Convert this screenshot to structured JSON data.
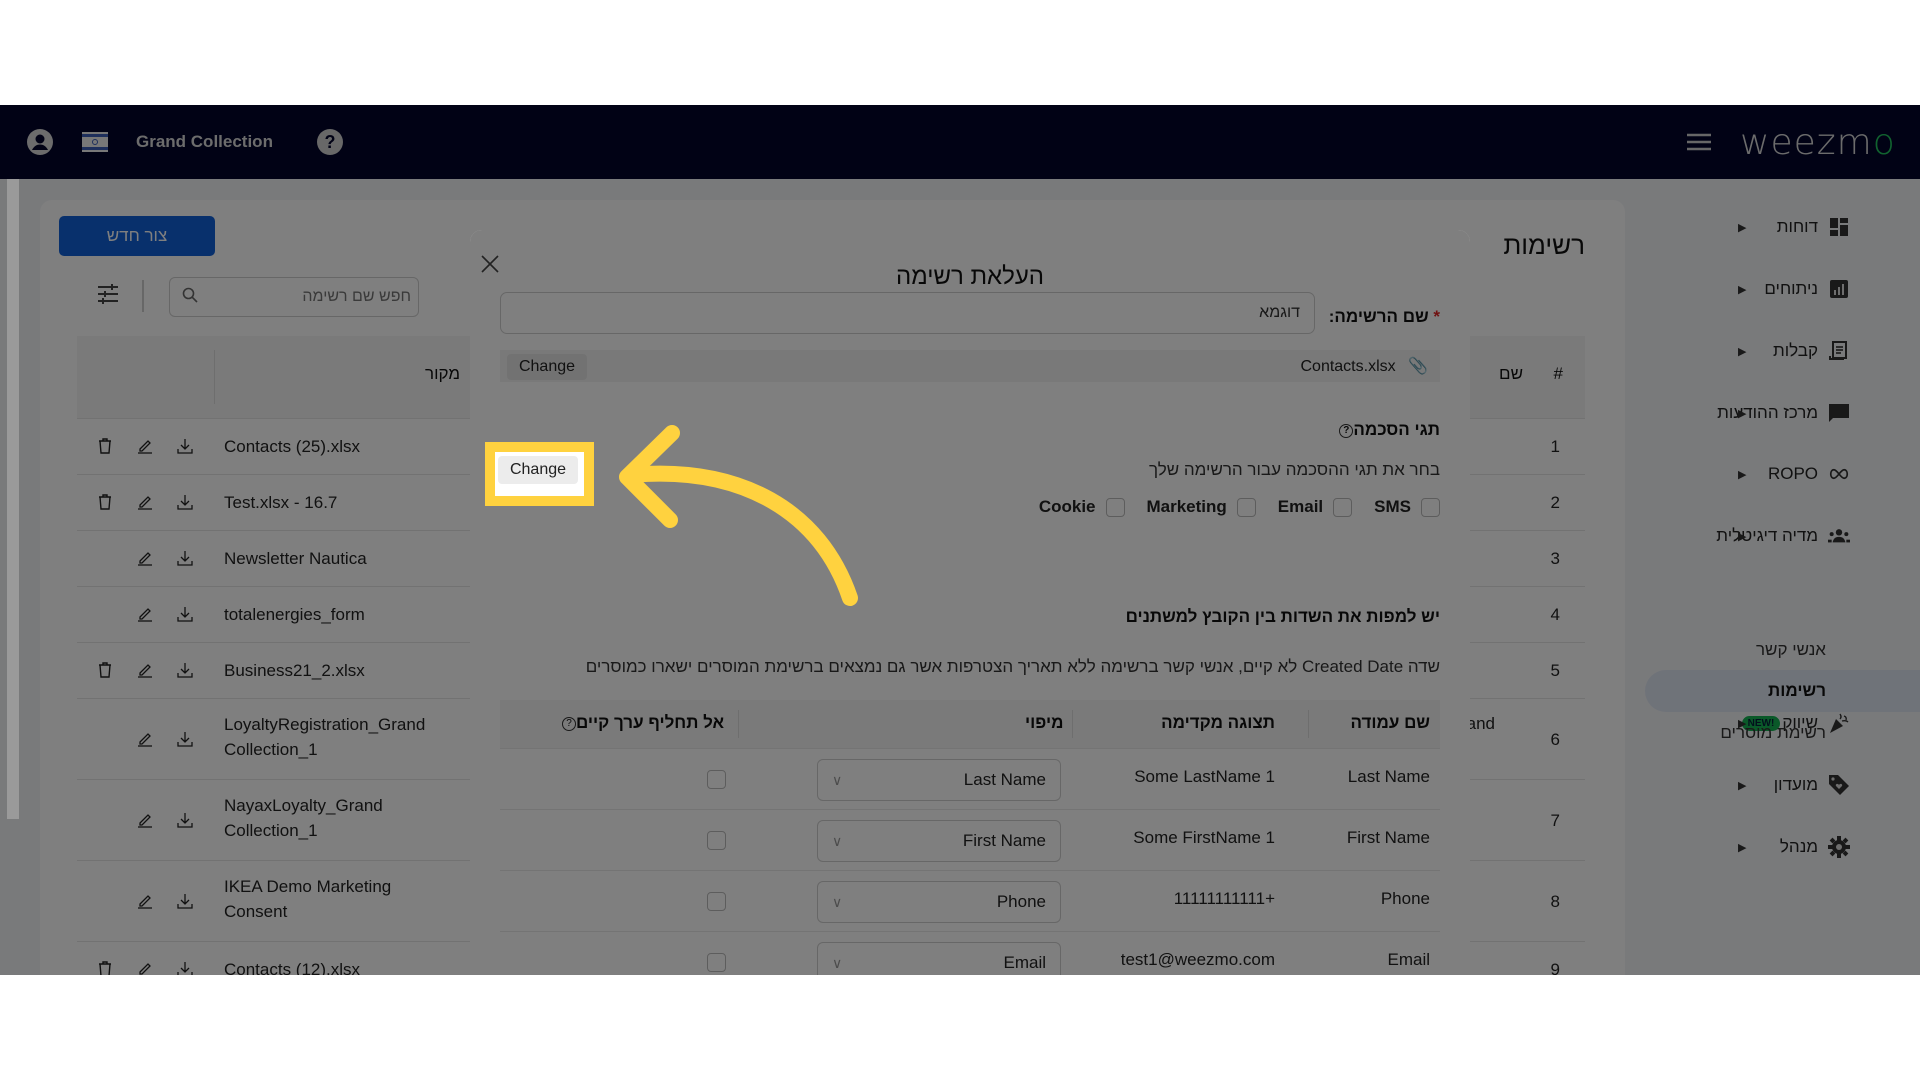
{
  "topbar": {
    "account_name": "Grand Collection",
    "user_icon": "user-circle-icon",
    "flag_icon": "israel-flag-icon",
    "help_icon": "help-circle-icon",
    "menu_icon": "hamburger-menu-icon",
    "logo": {
      "text_main": "weezm",
      "text_accent": "o"
    },
    "accent_color": "#22c55e",
    "bar_color": "#02052b"
  },
  "sidenav": {
    "items": [
      {
        "label": "דוחות",
        "icon": "dashboard-icon",
        "expanded": false
      },
      {
        "label": "ניתוחים",
        "icon": "bar-chart-icon",
        "expanded": false
      },
      {
        "label": "קבלות",
        "icon": "receipt-icon",
        "expanded": false
      },
      {
        "label": "מרכז ההודעות",
        "icon": "message-icon",
        "expanded": false
      },
      {
        "label": "ROPO",
        "icon": "infinity-icon",
        "expanded": false
      },
      {
        "label": "מדיה דיגיטלית",
        "icon": "people-icon",
        "expanded": false
      },
      {
        "label": "אנשי קשר",
        "icon": "contact-card-icon",
        "expanded": true,
        "badge": "NEW!"
      },
      {
        "label": "שיווק",
        "icon": "party-popper-icon",
        "expanded": false,
        "badge": "NEW!"
      },
      {
        "label": "מועדון",
        "icon": "tag-heart-icon",
        "expanded": false
      },
      {
        "label": "מנהל",
        "icon": "gear-icon",
        "expanded": false
      }
    ],
    "subitems": [
      {
        "label": "אנשי קשר",
        "active": false
      },
      {
        "label": "רשימות",
        "active": true
      },
      {
        "label": "רשימת מוסרים",
        "active": false
      }
    ]
  },
  "page": {
    "title": "רשימות",
    "new_button": "צור חדש",
    "search_placeholder": "חפש שם רשימה",
    "columns": {
      "number": "#",
      "name": "שם",
      "source": "מקור"
    },
    "rows": [
      {
        "num": "1",
        "source": "Contacts (25).xlsx",
        "deletable": true
      },
      {
        "num": "2",
        "source": "Test.xlsx - 16.7",
        "deletable": true
      },
      {
        "num": "3",
        "source": "Newsletter Nautica",
        "deletable": false
      },
      {
        "num": "4",
        "source": "totalenergies_form",
        "deletable": false
      },
      {
        "num": "5",
        "source": "Business21_2.xlsx",
        "deletable": true
      },
      {
        "num": "6",
        "source": "LoyaltyRegistration_Grand Collection_1",
        "deletable": false,
        "name_fragment": "and"
      },
      {
        "num": "7",
        "source": "NayaxLoyalty_Grand Collection_1",
        "deletable": false
      },
      {
        "num": "8",
        "source": "IKEA Demo Marketing Consent",
        "deletable": false
      },
      {
        "num": "9",
        "source": "Contacts (12).xlsx",
        "deletable": true
      }
    ]
  },
  "modal": {
    "title": "העלאת רשימה",
    "close_icon": "close-icon",
    "name_label": "שם הרשימה:",
    "required_mark": "*",
    "name_value": "דוגמא",
    "file_name": "Contacts.xlsx",
    "change_button": "Change",
    "consent_title": "תגי הסכמה",
    "consent_desc": "בחר את תגי ההסכמה עבור הרשימה שלך",
    "consent_options": [
      {
        "label": "SMS",
        "checked": false
      },
      {
        "label": "Email",
        "checked": false
      },
      {
        "label": "Marketing",
        "checked": false
      },
      {
        "label": "Cookie",
        "checked": false
      }
    ],
    "mapping_title": "יש למפות את השדות בין הקובץ למשתנים",
    "mapping_note": "שדה Created Date לא קיים, אנשי קשר ברשימה ללא תאריך הצטרפות אשר גם נמצאים ברשימת המוסרים ישארו כמוסרים",
    "mapping_columns": {
      "column_name": "שם עמודה",
      "preview": "תצוגה מקדימה",
      "mapping": "מיפוי",
      "no_overwrite": "אל תחליף ערך קיים"
    },
    "mapping_rows": [
      {
        "column": "Last Name",
        "preview": "Some LastName 1",
        "mapping": "Last Name",
        "no_overwrite": false
      },
      {
        "column": "First Name",
        "preview": "Some FirstName 1",
        "mapping": "First Name",
        "no_overwrite": false
      },
      {
        "column": "Phone",
        "preview": "11111111111+",
        "mapping": "Phone",
        "no_overwrite": false
      },
      {
        "column": "Email",
        "preview": "test1@weezmo.com",
        "mapping": "Email",
        "no_overwrite": false
      }
    ]
  },
  "annotation": {
    "highlight_color": "#ffd23f",
    "target": "Change"
  }
}
